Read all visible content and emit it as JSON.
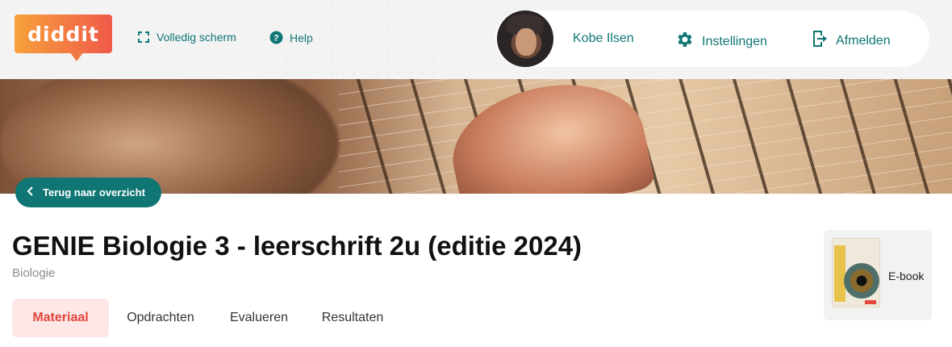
{
  "header": {
    "logo_text": "diddit",
    "fullscreen_label": "Volledig scherm",
    "help_label": "Help",
    "user_name": "Kobe Ilsen",
    "settings_label": "Instellingen",
    "logout_label": "Afmelden"
  },
  "hero": {
    "back_label": "Terug naar overzicht"
  },
  "course": {
    "title": "GENIE Biologie 3 - leerschrift 2u (editie 2024)",
    "subject": "Biologie"
  },
  "tabs": [
    {
      "label": "Materiaal",
      "active": true
    },
    {
      "label": "Opdrachten",
      "active": false
    },
    {
      "label": "Evalueren",
      "active": false
    },
    {
      "label": "Resultaten",
      "active": false
    }
  ],
  "ebook": {
    "label": "E-book"
  },
  "colors": {
    "primary_teal": "#0f7674",
    "active_tab_bg": "#fde7e7",
    "active_tab_text": "#e2453a",
    "logo_gradient_start": "#f7a13b",
    "logo_gradient_end": "#ef5a4a"
  },
  "icons": {
    "fullscreen": "expand-icon",
    "help": "question-circle-icon",
    "settings": "gear-icon",
    "logout": "logout-icon",
    "back": "chevron-left-icon"
  }
}
